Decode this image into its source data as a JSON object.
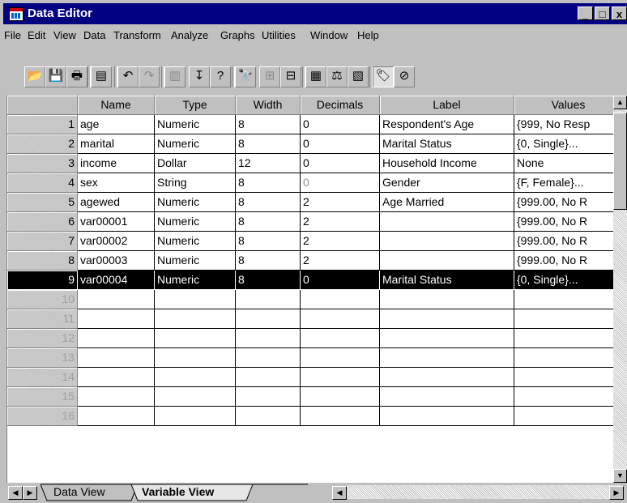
{
  "window": {
    "title": "Data Editor"
  },
  "title_buttons": {
    "minimize": "_",
    "maximize": "□",
    "close": "x"
  },
  "menu": [
    "File",
    "Edit",
    "View",
    "Data",
    "Transform",
    "Analyze",
    "Graphs",
    "Utilities",
    "Window",
    "Help"
  ],
  "toolbar": [
    {
      "name": "open-file-icon",
      "glyph": "📂",
      "disabled": false
    },
    {
      "name": "save-icon",
      "glyph": "💾",
      "disabled": false
    },
    {
      "name": "print-icon",
      "glyph": "🖶",
      "disabled": false
    },
    {
      "name": "dialog-recall-icon",
      "glyph": "▤",
      "disabled": false
    },
    {
      "name": "undo-icon",
      "glyph": "↶",
      "disabled": false
    },
    {
      "name": "redo-icon",
      "glyph": "↷",
      "disabled": true
    },
    {
      "name": "goto-chart-icon",
      "glyph": "▥",
      "disabled": true
    },
    {
      "name": "goto-case-icon",
      "glyph": "↧",
      "disabled": false
    },
    {
      "name": "variables-icon",
      "glyph": "?",
      "disabled": false
    },
    {
      "name": "find-icon",
      "glyph": "🔭",
      "disabled": false
    },
    {
      "name": "insert-case-icon",
      "glyph": "⊞",
      "disabled": true
    },
    {
      "name": "insert-variable-icon",
      "glyph": "⊟",
      "disabled": false
    },
    {
      "name": "split-file-icon",
      "glyph": "▦",
      "disabled": false
    },
    {
      "name": "weight-cases-icon",
      "glyph": "⚖",
      "disabled": false
    },
    {
      "name": "select-cases-icon",
      "glyph": "▧",
      "disabled": false
    },
    {
      "name": "value-labels-icon",
      "glyph": "🏷",
      "disabled": false,
      "pressed": true
    },
    {
      "name": "use-sets-icon",
      "glyph": "⊘",
      "disabled": false
    }
  ],
  "columns": [
    "Name",
    "Type",
    "Width",
    "Decimals",
    "Label",
    "Values"
  ],
  "rows": [
    {
      "num": "1",
      "name": "age",
      "type": "Numeric",
      "width": "8",
      "decimals": "0",
      "label": "Respondent's Age",
      "values": "{999, No Resp"
    },
    {
      "num": "2",
      "name": "marital",
      "type": "Numeric",
      "width": "8",
      "decimals": "0",
      "label": "Marital Status",
      "values": "{0, Single}..."
    },
    {
      "num": "3",
      "name": "income",
      "type": "Dollar",
      "width": "12",
      "decimals": "0",
      "label": "Household Income",
      "values": "None"
    },
    {
      "num": "4",
      "name": "sex",
      "type": "String",
      "width": "8",
      "decimals": "0",
      "label": "Gender",
      "values": "{F, Female}..."
    },
    {
      "num": "5",
      "name": "agewed",
      "type": "Numeric",
      "width": "8",
      "decimals": "2",
      "label": "Age Married",
      "values": "{999.00, No R"
    },
    {
      "num": "6",
      "name": "var00001",
      "type": "Numeric",
      "width": "8",
      "decimals": "2",
      "label": "",
      "values": "{999.00, No R"
    },
    {
      "num": "7",
      "name": "var00002",
      "type": "Numeric",
      "width": "8",
      "decimals": "2",
      "label": "",
      "values": "{999.00, No R"
    },
    {
      "num": "8",
      "name": "var00003",
      "type": "Numeric",
      "width": "8",
      "decimals": "2",
      "label": "",
      "values": "{999.00, No R"
    },
    {
      "num": "9",
      "name": "var00004",
      "type": "Numeric",
      "width": "8",
      "decimals": "0",
      "label": "Marital Status",
      "values": "{0, Single}..."
    }
  ],
  "empty_rows": [
    "10",
    "11",
    "12",
    "13",
    "14",
    "15",
    "16"
  ],
  "tabs": {
    "data_view": "Data View",
    "variable_view": "Variable View"
  }
}
